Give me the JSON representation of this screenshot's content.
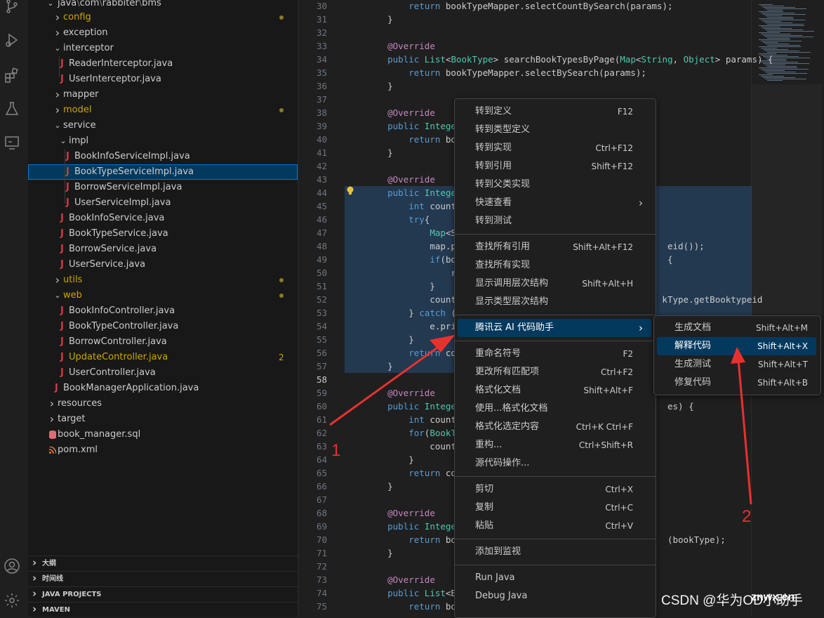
{
  "colors": {
    "accent": "#0078d4",
    "modified_folder": "#cca700",
    "java_icon": "#cc3e44",
    "keyword": "#569cd6",
    "annotation": "#c586c0",
    "arrow": "#e8312f"
  },
  "activity_bar": [
    "source-control-icon",
    "run-debug-icon",
    "extensions-icon",
    "testing-icon",
    "remote-explorer-icon",
    "account-icon",
    "settings-gear-icon"
  ],
  "explorer": {
    "path": {
      "a": "java",
      "b": "com",
      "c": "rabbiter",
      "d": "bms"
    },
    "tree": [
      {
        "label": "config",
        "kind": "folder",
        "open": false,
        "color": "#cca700",
        "dot": true
      },
      {
        "label": "exception",
        "kind": "folder",
        "open": false
      },
      {
        "label": "interceptor",
        "kind": "folder",
        "open": true
      },
      {
        "label": "ReaderInterceptor.java",
        "kind": "java"
      },
      {
        "label": "UserInterceptor.java",
        "kind": "java"
      },
      {
        "label": "mapper",
        "kind": "folder",
        "open": false
      },
      {
        "label": "model",
        "kind": "folder",
        "open": false,
        "color": "#cca700",
        "dot": true
      },
      {
        "label": "service",
        "kind": "folder",
        "open": true
      },
      {
        "label": "impl",
        "kind": "folder",
        "open": true
      },
      {
        "label": "BookInfoServiceImpl.java",
        "kind": "java"
      },
      {
        "label": "BookTypeServiceImpl.java",
        "kind": "java",
        "selected": true
      },
      {
        "label": "BorrowServiceImpl.java",
        "kind": "java"
      },
      {
        "label": "UserServiceImpl.java",
        "kind": "java"
      },
      {
        "label": "BookInfoService.java",
        "kind": "java"
      },
      {
        "label": "BookTypeService.java",
        "kind": "java"
      },
      {
        "label": "BorrowService.java",
        "kind": "java"
      },
      {
        "label": "UserService.java",
        "kind": "java"
      },
      {
        "label": "utils",
        "kind": "folder",
        "open": false,
        "color": "#cca700",
        "dot": true
      },
      {
        "label": "web",
        "kind": "folder",
        "open": true,
        "color": "#cca700",
        "dot": true
      },
      {
        "label": "BookInfoController.java",
        "kind": "java"
      },
      {
        "label": "BookTypeController.java",
        "kind": "java"
      },
      {
        "label": "BorrowController.java",
        "kind": "java"
      },
      {
        "label": "UpdateController.java",
        "kind": "java",
        "color": "#cca700",
        "badge": "2"
      },
      {
        "label": "UserController.java",
        "kind": "java"
      },
      {
        "label": "BookManagerApplication.java",
        "kind": "java"
      },
      {
        "label": "resources",
        "kind": "folder",
        "open": false
      },
      {
        "label": "target",
        "kind": "folder",
        "open": false
      },
      {
        "label": "book_manager.sql",
        "kind": "sql"
      },
      {
        "label": "pom.xml",
        "kind": "xml"
      }
    ],
    "panels": [
      "大纲",
      "时间线",
      "JAVA PROJECTS",
      "MAVEN"
    ]
  },
  "editor": {
    "active_line": 58,
    "lines": [
      {
        "n": 30,
        "code": "        return bookTypeMapper.selectCountBySearch(params);"
      },
      {
        "n": 31,
        "code": "    }"
      },
      {
        "n": 32,
        "code": ""
      },
      {
        "n": 33,
        "code": "    @Override"
      },
      {
        "n": 34,
        "code": "    public List<BookType> searchBookTypesByPage(Map<String, Object> params) {"
      },
      {
        "n": 35,
        "code": "        return bookTypeMapper.selectBySearch(params);"
      },
      {
        "n": 36,
        "code": "    }"
      },
      {
        "n": 37,
        "code": ""
      },
      {
        "n": 38,
        "code": "    @Override"
      },
      {
        "n": 39,
        "code": "    public Integer a"
      },
      {
        "n": 40,
        "code": "        return bookT"
      },
      {
        "n": 41,
        "code": "    }"
      },
      {
        "n": 42,
        "code": ""
      },
      {
        "n": 43,
        "code": "    @Override"
      },
      {
        "n": 44,
        "code": "    public Integer d"
      },
      {
        "n": 45,
        "code": "        int count = "
      },
      {
        "n": 46,
        "code": "        try{"
      },
      {
        "n": 47,
        "code": "            Map<Stri"
      },
      {
        "n": 48,
        "code": "            map.put(                                     eid());"
      },
      {
        "n": 49,
        "code": "            if(bookI                                     {"
      },
      {
        "n": 50,
        "code": "                retu"
      },
      {
        "n": 51,
        "code": "            }"
      },
      {
        "n": 52,
        "code": "            count =                                     kType.getBooktypeid"
      },
      {
        "n": 53,
        "code": "        } catch (Exc"
      },
      {
        "n": 54,
        "code": "            e.printS"
      },
      {
        "n": 55,
        "code": "        }"
      },
      {
        "n": 56,
        "code": "        return count"
      },
      {
        "n": 57,
        "code": "    }"
      },
      {
        "n": 58,
        "code": ""
      },
      {
        "n": 59,
        "code": "    @Override"
      },
      {
        "n": 60,
        "code": "    public Integer d                                     es) {"
      },
      {
        "n": 61,
        "code": "        int count = "
      },
      {
        "n": 62,
        "code": "        for(BookType"
      },
      {
        "n": 63,
        "code": "            count +="
      },
      {
        "n": 64,
        "code": "        }"
      },
      {
        "n": 65,
        "code": "        return count"
      },
      {
        "n": 66,
        "code": "    }"
      },
      {
        "n": 67,
        "code": ""
      },
      {
        "n": 68,
        "code": "    @Override"
      },
      {
        "n": 69,
        "code": "    public Integer u"
      },
      {
        "n": 70,
        "code": "        return bookT                                     (bookType);"
      },
      {
        "n": 71,
        "code": "    }"
      },
      {
        "n": 72,
        "code": ""
      },
      {
        "n": 73,
        "code": "    @Override"
      },
      {
        "n": 74,
        "code": "    public List<Book"
      },
      {
        "n": 75,
        "code": "        return bookT"
      }
    ]
  },
  "context_menu": {
    "groups": [
      [
        {
          "label": "转到定义",
          "key": "F12"
        },
        {
          "label": "转到类型定义",
          "key": ""
        },
        {
          "label": "转到实现",
          "key": "Ctrl+F12"
        },
        {
          "label": "转到引用",
          "key": "Shift+F12"
        },
        {
          "label": "转到父类实现",
          "key": ""
        },
        {
          "label": "快速查看",
          "key": "",
          "submenu": true
        },
        {
          "label": "转到测试",
          "key": ""
        }
      ],
      [
        {
          "label": "查找所有引用",
          "key": "Shift+Alt+F12"
        },
        {
          "label": "查找所有实现",
          "key": ""
        },
        {
          "label": "显示调用层次结构",
          "key": "Shift+Alt+H"
        },
        {
          "label": "显示类型层次结构",
          "key": ""
        }
      ],
      [
        {
          "label": "腾讯云 AI 代码助手",
          "key": "",
          "submenu": true,
          "highlighted": true
        }
      ],
      [
        {
          "label": "重命名符号",
          "key": "F2"
        },
        {
          "label": "更改所有匹配项",
          "key": "Ctrl+F2"
        },
        {
          "label": "格式化文档",
          "key": "Shift+Alt+F"
        },
        {
          "label": "使用...格式化文档",
          "key": ""
        },
        {
          "label": "格式化选定内容",
          "key": "Ctrl+K Ctrl+F"
        },
        {
          "label": "重构...",
          "key": "Ctrl+Shift+R"
        },
        {
          "label": "源代码操作...",
          "key": ""
        }
      ],
      [
        {
          "label": "剪切",
          "key": "Ctrl+X"
        },
        {
          "label": "复制",
          "key": "Ctrl+C"
        },
        {
          "label": "粘贴",
          "key": "Ctrl+V"
        }
      ],
      [
        {
          "label": "添加到监视",
          "key": ""
        }
      ],
      [
        {
          "label": "Run Java",
          "key": ""
        },
        {
          "label": "Debug Java",
          "key": ""
        }
      ]
    ]
  },
  "submenu": {
    "items": [
      {
        "label": "生成文档",
        "key": "Shift+Alt+M"
      },
      {
        "label": "解释代码",
        "key": "Shift+Alt+X",
        "highlighted": true
      },
      {
        "label": "生成测试",
        "key": "Shift+Alt+T"
      },
      {
        "label": "修复代码",
        "key": "Shift+Alt+B"
      }
    ]
  },
  "annotations": {
    "arrow1_label": "1",
    "arrow2_label": "2"
  },
  "watermark": "CSDN @华为OD小助手",
  "watermark_overlay": "znwx.cn"
}
